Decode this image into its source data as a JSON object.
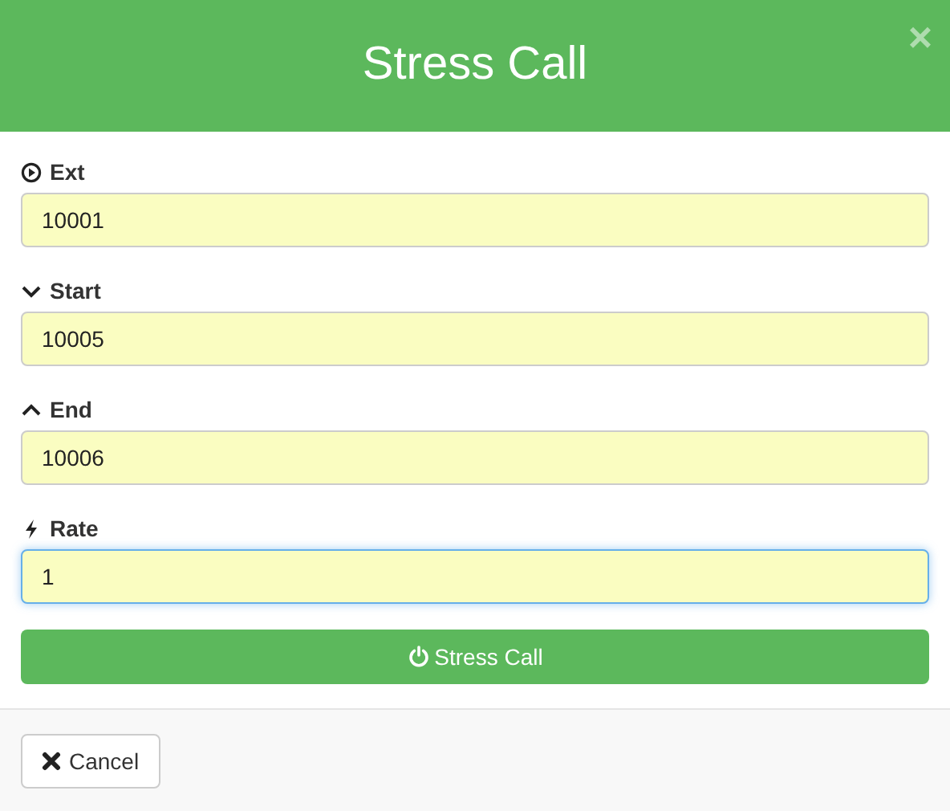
{
  "dialog": {
    "title": "Stress Call",
    "close": "×"
  },
  "fields": [
    {
      "label": "Ext",
      "value": "10001",
      "focused": false
    },
    {
      "label": "Start",
      "value": "10005",
      "focused": false
    },
    {
      "label": "End",
      "value": "10006",
      "focused": false
    },
    {
      "label": "Rate",
      "value": "1",
      "focused": true
    }
  ],
  "submit_button": "Stress Call",
  "cancel_button": "Cancel"
}
